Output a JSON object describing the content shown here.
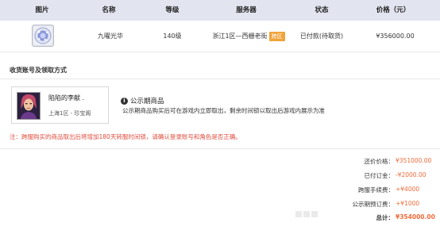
{
  "table": {
    "headers": [
      "图片",
      "名称",
      "等级",
      "服务器",
      "状态",
      "价格（元）"
    ],
    "item": {
      "image_icon": "gem-ring-icon",
      "name": "九曜光华",
      "level": "140级",
      "server": "浙江1区—西栅老街",
      "server_tag": "跨区",
      "status": "已付款(待取货)",
      "price": "¥356000.00"
    }
  },
  "delivery": {
    "section_title": "收货账号及领取方式",
    "seller": {
      "name": "陷陷的李献 .",
      "location": "上海1区 - 珍宝阁",
      "avatar_icon": "character-avatar-icon"
    },
    "public_period": {
      "title": "公示期商品",
      "description": "公示期商品购买后可在游戏内立即取出，剩余时间锁以取出后游戏内展示为准"
    },
    "notice": "注：跨服购买的商品取出后将增加180天转服时间锁，请确认登录账号和角色是否正确。"
  },
  "summary": [
    {
      "label": "还价价格：",
      "value": "¥351000.00"
    },
    {
      "label": "已付订金：",
      "value": "-¥2000.00"
    },
    {
      "label": "跨服手续费：",
      "value": "+¥4000"
    },
    {
      "label": "公示期预订费：",
      "value": "+¥1000"
    },
    {
      "label": "总计：",
      "value": "¥354000.00"
    }
  ],
  "colors": {
    "header_bg": "#e2e4ef",
    "accent_price": "#f26b3a",
    "notice_red": "#e04b3c",
    "tag_orange": "#f0a43b"
  }
}
